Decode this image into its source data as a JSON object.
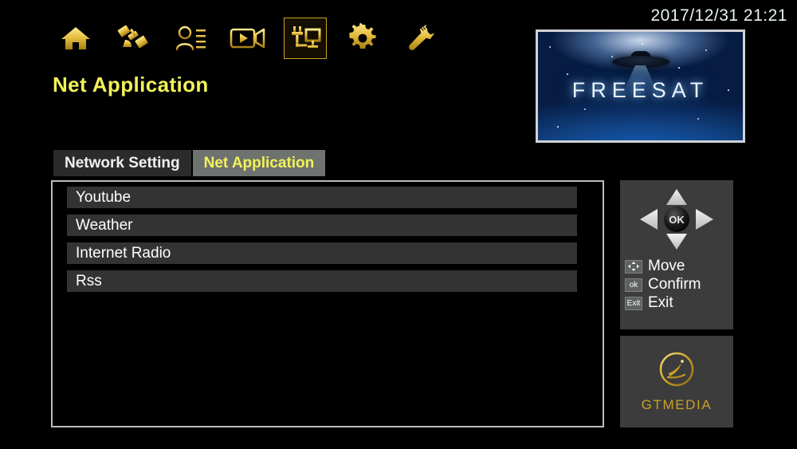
{
  "clock": {
    "datetime": "2017/12/31  21:21"
  },
  "page": {
    "title": "Net Application"
  },
  "navbar": {
    "items": [
      {
        "name": "home-icon",
        "label": "Home",
        "active": false
      },
      {
        "name": "satellite-icon",
        "label": "Satellite",
        "active": false
      },
      {
        "name": "user-list-icon",
        "label": "Channel List",
        "active": false
      },
      {
        "name": "video-camera-icon",
        "label": "Media",
        "active": false
      },
      {
        "name": "network-monitor-icon",
        "label": "Net Application",
        "active": true
      },
      {
        "name": "gear-icon",
        "label": "Settings",
        "active": false
      },
      {
        "name": "wrench-icon",
        "label": "Tools",
        "active": false
      }
    ]
  },
  "preview": {
    "brand": "FREESAT"
  },
  "tabs": [
    {
      "label": "Network Setting",
      "active": false
    },
    {
      "label": "Net Application",
      "active": true
    }
  ],
  "list": {
    "items": [
      {
        "label": "Youtube"
      },
      {
        "label": "Weather"
      },
      {
        "label": "Internet Radio"
      },
      {
        "label": "Rss"
      }
    ]
  },
  "help": {
    "dpad": {
      "ok_label": "OK"
    },
    "legend": [
      {
        "key": "arrows",
        "key_label": "",
        "label": "Move"
      },
      {
        "key": "ok",
        "key_label": "ok",
        "label": "Confirm"
      },
      {
        "key": "exit",
        "key_label": "Exit",
        "label": "Exit"
      }
    ]
  },
  "brand": {
    "name": "GTMEDIA"
  },
  "colors": {
    "gold": "#c9a227",
    "yellow": "#f2f258",
    "panel_gray": "#3c3c3c",
    "row_gray": "#333333",
    "tab_active": "#6e7370",
    "tab_inactive": "#2b2b2b",
    "border_light": "#b9bcbd",
    "background": "#000000"
  }
}
